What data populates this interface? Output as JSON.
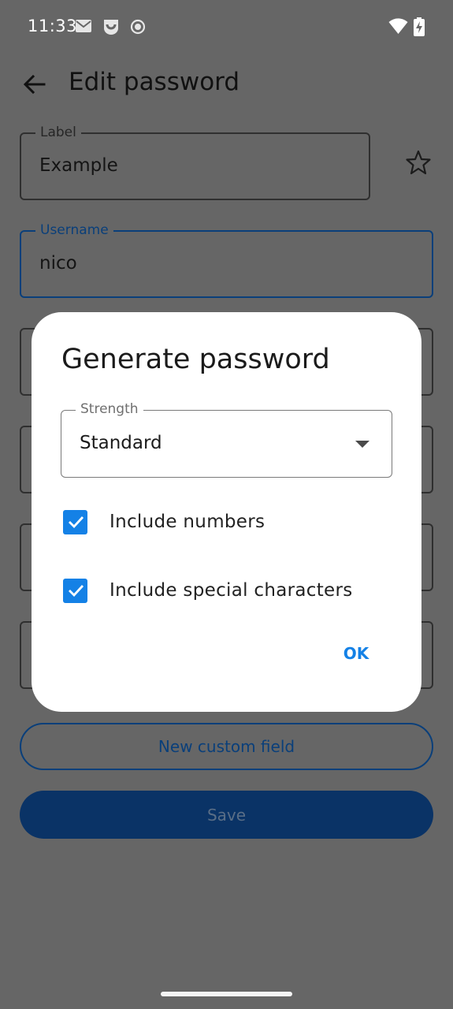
{
  "status_bar": {
    "time": "11:33",
    "icons_left": [
      "mail-icon",
      "app-notification-icon",
      "record-icon"
    ],
    "icons_right": [
      "wifi-icon",
      "battery-charging-icon"
    ]
  },
  "app_bar": {
    "title": "Edit password",
    "back_icon": "arrow-back-icon"
  },
  "form": {
    "label_field": {
      "label": "Label",
      "value": "Example"
    },
    "favorite_icon": "star-outline-icon",
    "username_field": {
      "label": "Username",
      "value": "nico"
    },
    "custom_field_button": "New custom field",
    "save_button": "Save"
  },
  "dialog": {
    "title": "Generate password",
    "strength": {
      "label": "Strength",
      "value": "Standard"
    },
    "options": [
      {
        "label": "Include numbers",
        "checked": true
      },
      {
        "label": "Include special characters",
        "checked": true
      }
    ],
    "ok_button": "OK"
  },
  "colors": {
    "scrim": "#666666",
    "accent": "#1481e6",
    "primary_dark": "#0a3366",
    "dialog_bg": "#ffffff"
  }
}
